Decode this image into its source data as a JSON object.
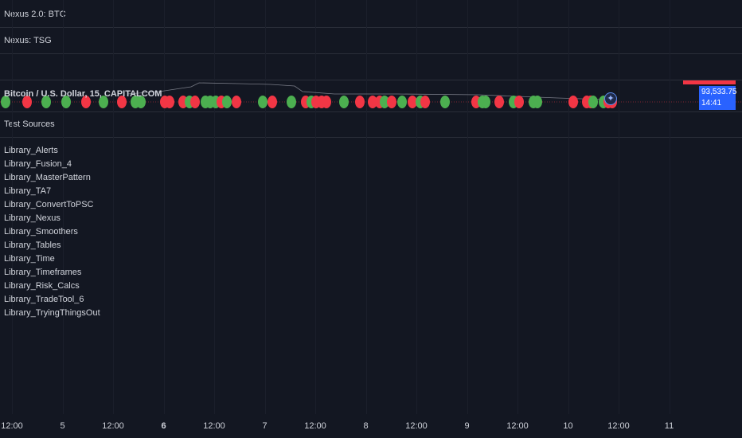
{
  "panes": {
    "btc_title": "Nexus 2.0: BTC",
    "tsg_title": "Nexus: TSG",
    "test_title": "Test Sources"
  },
  "main": {
    "symbol_title": "Bitcoin / U.S. Dollar, 15, CAPITALCOM",
    "price": "93,533.75",
    "countdown": "14:41",
    "colors": {
      "bull": "#4caf50",
      "bear": "#f23645",
      "price_tag": "#2962ff"
    }
  },
  "libraries": [
    "Library_Alerts",
    "Library_Fusion_4",
    "Library_MasterPattern",
    "Library_TA7",
    "Library_ConvertToPSC",
    "Library_Nexus",
    "Library_Smoothers",
    "Library_Tables",
    "Library_Time",
    "Library_Timeframes",
    "Library_Risk_Calcs",
    "Library_TradeTool_6",
    "Library_TryingThingsOut"
  ],
  "time_axis": [
    {
      "label": "12:00",
      "bold": false
    },
    {
      "label": "5",
      "bold": false
    },
    {
      "label": "12:00",
      "bold": false
    },
    {
      "label": "6",
      "bold": true
    },
    {
      "label": "12:00",
      "bold": false
    },
    {
      "label": "7",
      "bold": false
    },
    {
      "label": "12:00",
      "bold": false
    },
    {
      "label": "8",
      "bold": false
    },
    {
      "label": "12:00",
      "bold": false
    },
    {
      "label": "9",
      "bold": false
    },
    {
      "label": "12:00",
      "bold": false
    },
    {
      "label": "10",
      "bold": false
    },
    {
      "label": "12:00",
      "bold": false
    },
    {
      "label": "11",
      "bold": false
    }
  ],
  "signals": [
    {
      "c": "g"
    },
    {
      "c": "r"
    },
    {
      "c": "g"
    },
    {
      "c": "g"
    },
    {
      "c": "r"
    },
    {
      "c": "g"
    },
    {
      "c": "r"
    },
    {
      "c": "g"
    },
    {
      "c": "g"
    },
    {
      "c": "r"
    },
    {
      "c": "r"
    },
    {
      "c": "r"
    },
    {
      "c": "g"
    },
    {
      "c": "r"
    },
    {
      "c": "g"
    },
    {
      "c": "g"
    },
    {
      "c": "g"
    },
    {
      "c": "r"
    },
    {
      "c": "g"
    },
    {
      "c": "r"
    },
    {
      "c": "g"
    },
    {
      "c": "r"
    },
    {
      "c": "g"
    },
    {
      "c": "r"
    },
    {
      "c": "g"
    },
    {
      "c": "r"
    },
    {
      "c": "r"
    },
    {
      "c": "r"
    },
    {
      "c": "g"
    },
    {
      "c": "r"
    },
    {
      "c": "r"
    },
    {
      "c": "r"
    },
    {
      "c": "g"
    },
    {
      "c": "r"
    },
    {
      "c": "g"
    },
    {
      "c": "r"
    },
    {
      "c": "g"
    },
    {
      "c": "r"
    },
    {
      "c": "g"
    },
    {
      "c": "r"
    },
    {
      "c": "g"
    },
    {
      "c": "g"
    },
    {
      "c": "r"
    },
    {
      "c": "g"
    },
    {
      "c": "r"
    },
    {
      "c": "g"
    },
    {
      "c": "g"
    },
    {
      "c": "r"
    },
    {
      "c": "r"
    },
    {
      "c": "r"
    },
    {
      "c": "g"
    },
    {
      "c": "g"
    },
    {
      "c": "r"
    },
    {
      "c": "r"
    }
  ]
}
